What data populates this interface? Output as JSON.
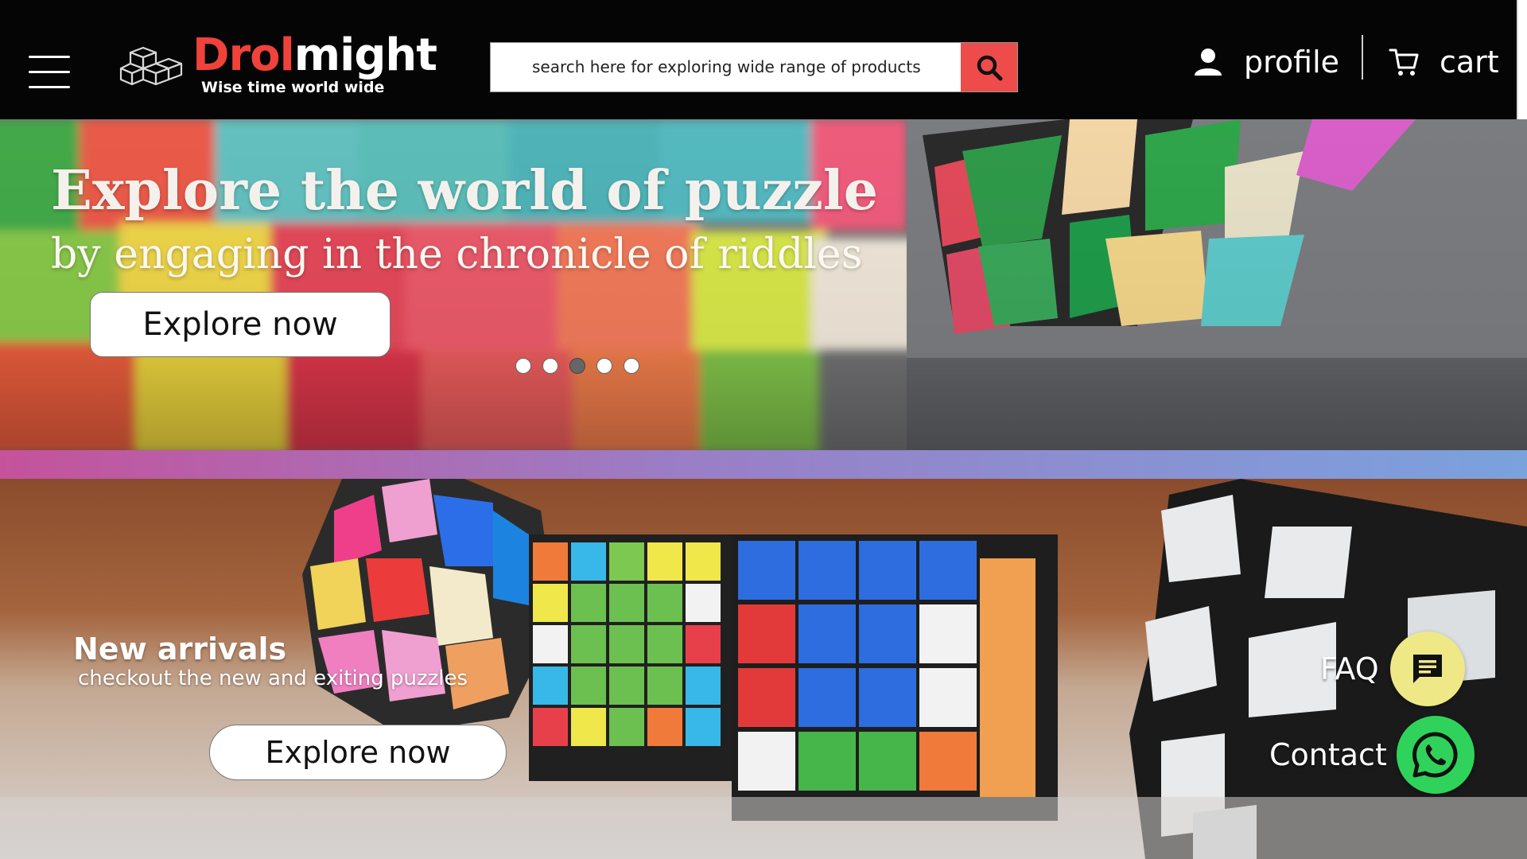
{
  "header": {
    "brand_part1": "Drol",
    "brand_part2": "might",
    "tagline": "Wise time world wide",
    "search_placeholder": "search here for exploring wide range of products",
    "profile_label": "profile",
    "cart_label": "cart"
  },
  "hero": {
    "title": "Explore the world of puzzle",
    "subtitle": "by engaging in the chronicle of riddles",
    "button_label": "Explore now",
    "carousel_total": 5,
    "carousel_active_index": 3
  },
  "new_arrivals": {
    "title": "New arrivals",
    "subtitle": "checkout the new and exiting puzzles",
    "button_label": "Explore now"
  },
  "floating": {
    "faq_label": "FAQ",
    "contact_label": "Contact"
  },
  "colors": {
    "brand_red": "#f0423a",
    "header_bg": "#050505",
    "search_button": "#ee4b4b",
    "faq_button": "#eee887",
    "whatsapp_button": "#2fd35c"
  },
  "icons": [
    "menu-icon",
    "cubes-logo-icon",
    "search-icon",
    "user-icon",
    "cart-icon",
    "chat-icon",
    "whatsapp-icon"
  ]
}
